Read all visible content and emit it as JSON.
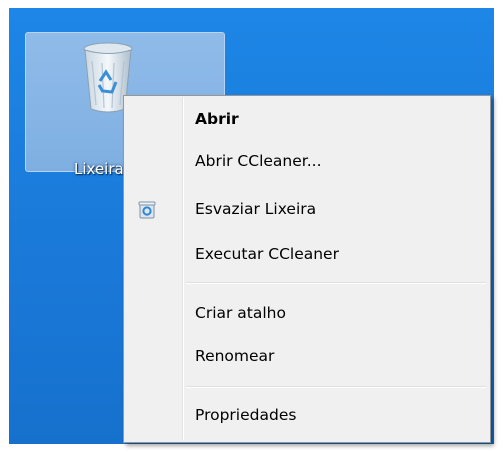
{
  "desktop": {
    "recycle_bin_icon": "recycle-bin-icon",
    "recycle_bin_label": "Lixeira"
  },
  "context_menu": {
    "items": [
      {
        "label": "Abrir",
        "bold": true
      },
      {
        "label": "Abrir CCleaner..."
      },
      {
        "label": "Esvaziar Lixeira",
        "icon": "recycle-bin-small-icon"
      },
      {
        "label": "Executar CCleaner"
      },
      {
        "label": "Criar atalho"
      },
      {
        "label": "Renomear"
      },
      {
        "label": "Propriedades"
      }
    ]
  },
  "colors": {
    "desktop_blue": "#1a78d8",
    "selection_highlight": "#8fbbe9",
    "menu_background": "#f0f0f0"
  }
}
